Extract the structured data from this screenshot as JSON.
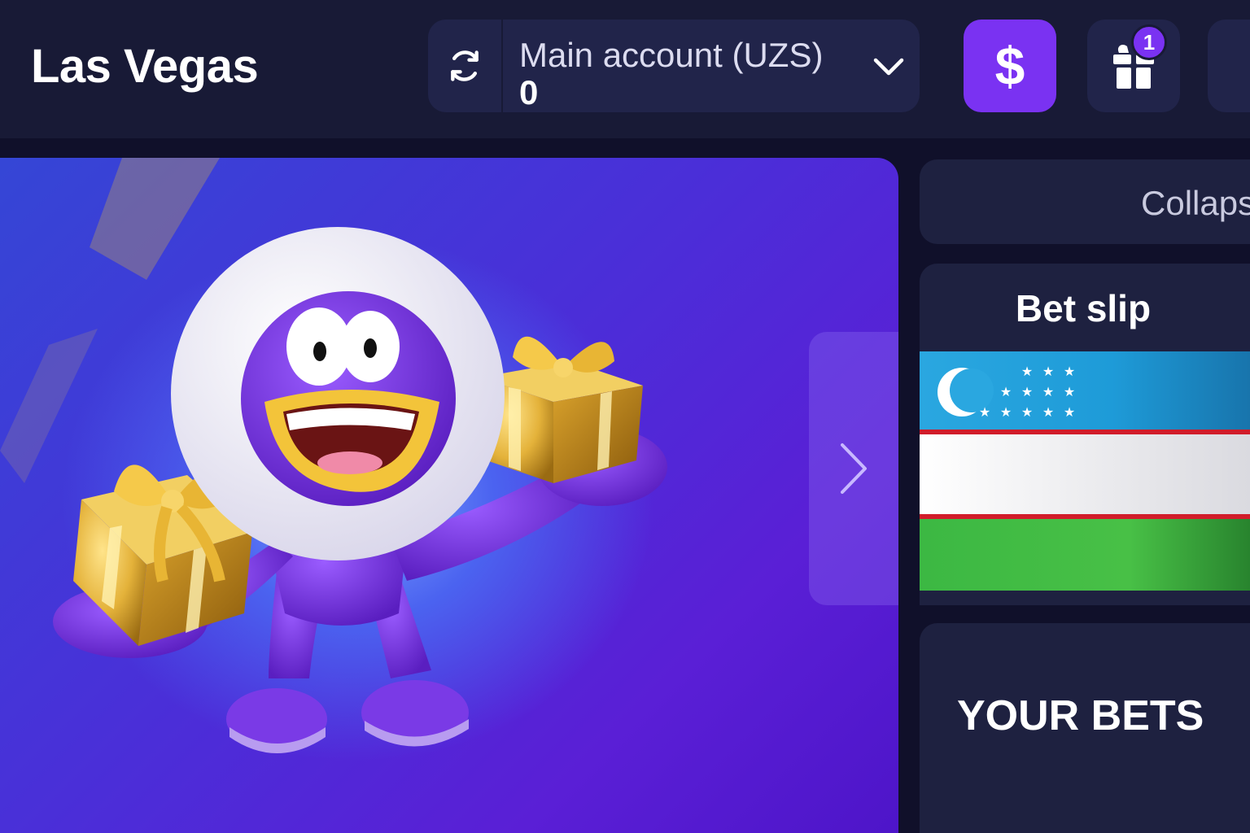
{
  "header": {
    "site_title": "Las Vegas",
    "account": {
      "name": "Main account (UZS)",
      "balance": "0"
    },
    "deposit_label": "$",
    "gift_badge_count": "1"
  },
  "icons": {
    "refresh": "refresh-icon",
    "account_dropdown": "chevron-down-icon",
    "gift": "gift-icon",
    "banner_next": "chevron-right-icon"
  },
  "sidebar": {
    "collapse_label": "Collaps",
    "betslip_title": "Bet slip",
    "your_bets_title": "YOUR BETS"
  },
  "colors": {
    "accent": "#7a32f2",
    "header_bg": "#181a36",
    "card_bg": "#1e2140",
    "flag_blue": "#1eb2e6",
    "flag_white": "#ffffff",
    "flag_green": "#1eb53a",
    "flag_red": "#ce1126"
  }
}
